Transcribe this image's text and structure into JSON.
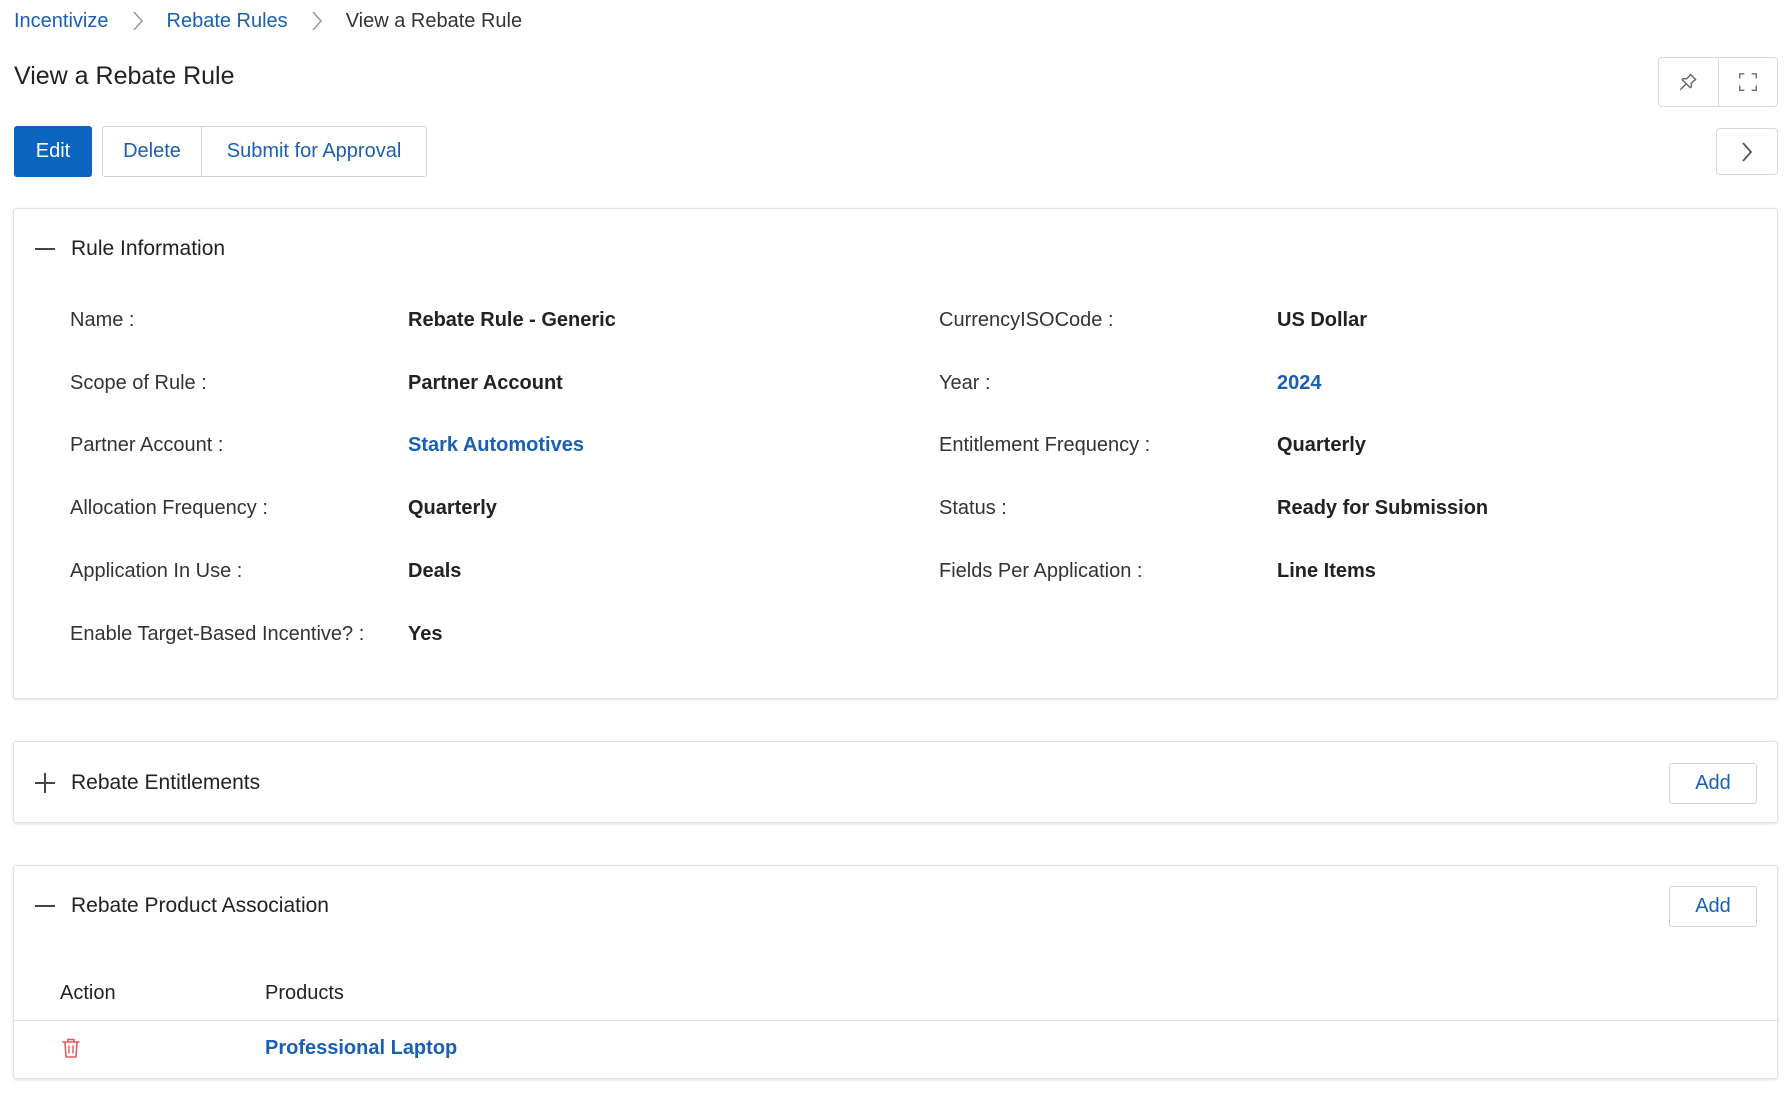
{
  "breadcrumb": {
    "items": [
      "Incentivize",
      "Rebate Rules",
      "View a Rebate Rule"
    ]
  },
  "page": {
    "title": "View a Rebate Rule"
  },
  "toolbar": {
    "edit_label": "Edit",
    "delete_label": "Delete",
    "submit_label": "Submit for Approval"
  },
  "rule_info": {
    "title": "Rule Information",
    "left": [
      {
        "label": "Name :",
        "value": "Rebate Rule - Generic"
      },
      {
        "label": "Scope of Rule :",
        "value": "Partner Account"
      },
      {
        "label": "Partner Account :",
        "value": "Stark Automotives"
      },
      {
        "label": "Allocation Frequency :",
        "value": "Quarterly"
      },
      {
        "label": "Application In Use :",
        "value": "Deals"
      },
      {
        "label": "Enable Target-Based Incentive? :",
        "value": "Yes"
      }
    ],
    "right": [
      {
        "label": "CurrencyISOCode :",
        "value": "US Dollar"
      },
      {
        "label": "Year :",
        "value": "2024"
      },
      {
        "label": "Entitlement Frequency :",
        "value": "Quarterly"
      },
      {
        "label": "Status :",
        "value": "Ready for Submission"
      },
      {
        "label": "Fields Per Application :",
        "value": "Line Items"
      }
    ]
  },
  "entitlements": {
    "title": "Rebate Entitlements",
    "add_label": "Add"
  },
  "product_association": {
    "title": "Rebate Product Association",
    "add_label": "Add",
    "columns": [
      "Action",
      "Products"
    ],
    "rows": [
      {
        "product": "Professional Laptop"
      }
    ]
  },
  "colors": {
    "primary": "#0b65bf",
    "link": "#1a5fb4",
    "danger": "#e05a5a"
  }
}
